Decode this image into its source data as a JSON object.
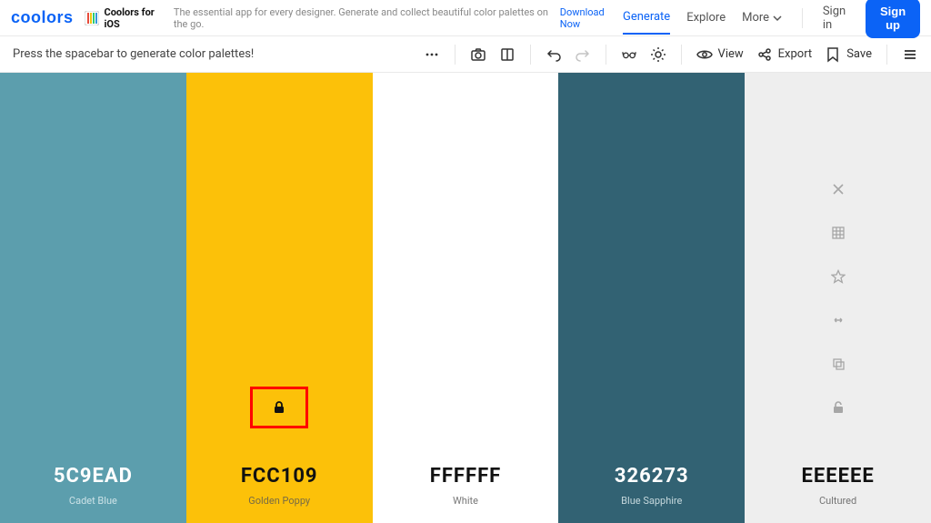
{
  "topbar": {
    "logo_text": "coolors",
    "promo_title": "Coolors for iOS",
    "promo_desc": "The essential app for every designer. Generate and collect beautiful color palettes on the go.",
    "promo_link": "Download Now",
    "nav": {
      "generate": "Generate",
      "explore": "Explore",
      "more": "More",
      "signin": "Sign in",
      "signup": "Sign up"
    }
  },
  "toolbar": {
    "hint": "Press the spacebar to generate color palettes!",
    "view": "View",
    "export": "Export",
    "save": "Save"
  },
  "palette": [
    {
      "hex": "5C9EAD",
      "name": "Cadet Blue",
      "bg": "#5C9EAD",
      "text": "light",
      "locked": false,
      "showTools": false
    },
    {
      "hex": "FCC109",
      "name": "Golden Poppy",
      "bg": "#FCC109",
      "text": "dark",
      "locked": true,
      "showTools": false
    },
    {
      "hex": "FFFFFF",
      "name": "White",
      "bg": "#FFFFFF",
      "text": "dark",
      "locked": false,
      "showTools": false
    },
    {
      "hex": "326273",
      "name": "Blue Sapphire",
      "bg": "#326273",
      "text": "light",
      "locked": false,
      "showTools": false
    },
    {
      "hex": "EEEEEE",
      "name": "Cultured",
      "bg": "#EEEEEE",
      "text": "dark",
      "locked": false,
      "showTools": true
    }
  ]
}
